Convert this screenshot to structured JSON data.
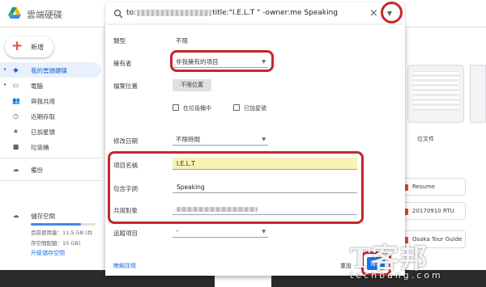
{
  "header": {
    "app_title": "雲端硬碟",
    "query_prefix": "to:",
    "query_suffix": "title:\"I.E.L.T \" -owner:me Speaking"
  },
  "sidebar": {
    "new_label": "新增",
    "items": [
      {
        "label": "我的雲端硬碟",
        "icon": "drive-icon",
        "active": true
      },
      {
        "label": "電腦",
        "icon": "computer-icon"
      },
      {
        "label": "與我共用",
        "icon": "people-icon"
      },
      {
        "label": "近期存取",
        "icon": "clock-icon"
      },
      {
        "label": "已加星號",
        "icon": "star-icon"
      },
      {
        "label": "垃圾桶",
        "icon": "trash-icon"
      }
    ],
    "backup_label": "備份",
    "storage_label": "儲存空間",
    "storage_used": "目前使用量：11.5 GB (共",
    "storage_quota": "存空間配額：15 GB)",
    "storage_fraction": 0.77,
    "upgrade_label": "升級儲存空間"
  },
  "dialog": {
    "type_label": "類型",
    "type_value": "不限",
    "owner_label": "擁有者",
    "owner_value": "非我擁有的項目",
    "location_label": "檔案位置",
    "location_button": "不限位置",
    "in_trash_label": "在垃圾桶中",
    "starred_label": "已加星號",
    "modified_label": "修改日期",
    "modified_value": "不限時間",
    "item_name_label": "項目名稱",
    "item_name_value": "I.E.L.T",
    "has_words_label": "包含字詞",
    "has_words_value": "Speaking",
    "shared_with_label": "共用對象",
    "followup_label": "追蹤項目",
    "followup_value": "–",
    "learn_more": "瞭解詳情",
    "reset": "重設",
    "search": "搜尋"
  },
  "background": {
    "file_label_partial": "位文件",
    "chips": [
      "Resume",
      "20170910 RTU",
      "Osaka Tour Guide"
    ]
  },
  "watermark": {
    "main": "T客邦",
    "sub": "techbang.com"
  },
  "colors": {
    "highlight": "#c6262e",
    "accent": "#1a73e8",
    "name_field_bg": "#f7f3b3"
  }
}
